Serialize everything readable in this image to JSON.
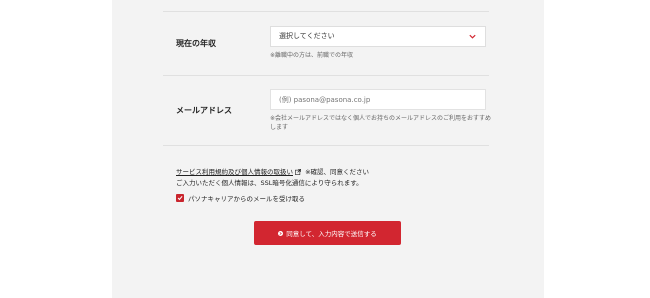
{
  "income": {
    "label": "現在の年収",
    "select_value": "選択してください",
    "note": "※離職中の方は、前職での年収"
  },
  "email": {
    "label": "メールアドレス",
    "placeholder": "(例) pasona@pasona.co.jp",
    "value": "",
    "note": "※会社メールアドレスではなく個人でお持ちのメールアドレスのご利用をおすすめします"
  },
  "terms": {
    "link_text": "サービス利用規約及び個人情報の取扱い",
    "confirm_text": "※確認、同意ください",
    "ssl_text": "ご入力いただく個人情報は、SSL暗号化通信により守られます。"
  },
  "optin": {
    "label": "パソナキャリアからのメールを受け取る",
    "checked": true
  },
  "submit": {
    "label": "同意して、入力内容で送信する"
  },
  "colors": {
    "accent": "#d22630",
    "panel": "#f3f3f3"
  }
}
